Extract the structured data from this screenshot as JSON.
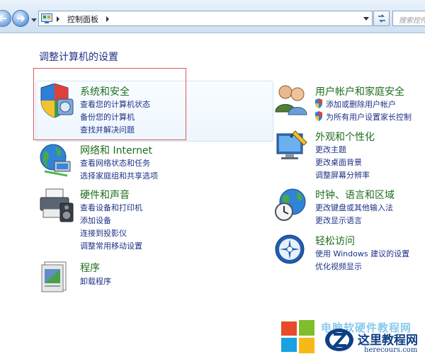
{
  "address_bar": {
    "path": "控制面板",
    "search_placeholder": "搜索控件"
  },
  "main": {
    "title": "调整计算机的设置",
    "categories": [
      {
        "title": "系统和安全",
        "links": [
          "查看您的计算机状态",
          "备份您的计算机",
          "查找并解决问题"
        ]
      },
      {
        "title": "网络和 Internet",
        "links": [
          "查看网络状态和任务",
          "选择家庭组和共享选项"
        ]
      },
      {
        "title": "硬件和声音",
        "links": [
          "查看设备和打印机",
          "添加设备",
          "连接到投影仪",
          "调整常用移动设置"
        ]
      },
      {
        "title": "程序",
        "links": [
          "卸载程序"
        ]
      },
      {
        "title": "用户帐户和家庭安全",
        "links": [
          "添加或删除用户帐户",
          "为所有用户设置家长控制"
        ]
      },
      {
        "title": "外观和个性化",
        "links": [
          "更改主题",
          "更改桌面背景",
          "调整屏幕分辨率"
        ]
      },
      {
        "title": "时钟、语言和区域",
        "links": [
          "更改键盘或其他输入法",
          "更改显示语言"
        ]
      },
      {
        "title": "轻松访问",
        "links": [
          "使用 Windows 建议的设置",
          "优化视频显示"
        ]
      }
    ]
  },
  "watermark": {
    "overlay_text": "电脑软硬件教程网",
    "site_zh": "这里教程网",
    "site_en": "herecours.com"
  },
  "colors": {
    "category_title": "#1f6e1f",
    "link": "#1e3287",
    "highlight_border": "#d65a5a"
  }
}
